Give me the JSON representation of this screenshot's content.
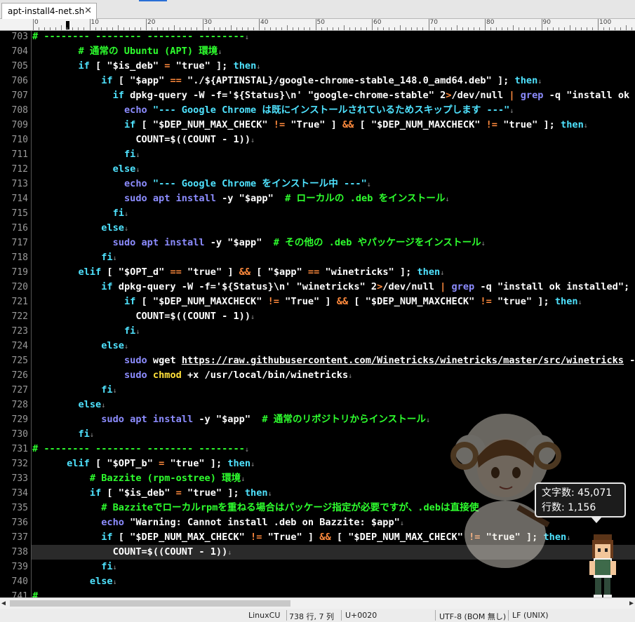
{
  "tab": {
    "title": "apt-install4-net.sh",
    "close": "✕"
  },
  "ruler": {
    "labels": [
      "0",
      "10",
      "20",
      "30",
      "40",
      "50",
      "60",
      "70",
      "80",
      "90",
      "100"
    ]
  },
  "editor": {
    "lines": [
      {
        "n": "703",
        "segs": [
          [
            "# -------- -------- -------- --------",
            "#2eff2e"
          ],
          [
            "↓",
            "#888"
          ]
        ]
      },
      {
        "n": "704",
        "segs": [
          [
            "        # 通常の Ubuntu (APT) 環境",
            "#2eff2e"
          ],
          [
            "↓",
            "#888"
          ]
        ]
      },
      {
        "n": "705",
        "segs": [
          [
            "        ",
            "#fff"
          ],
          [
            "if",
            "#4fe3ff"
          ],
          [
            " [ ",
            "#ffffff"
          ],
          [
            "\"$is_deb\"",
            "#ffffff"
          ],
          [
            " = ",
            "#ff8a3d"
          ],
          [
            "\"true\"",
            "#ffffff"
          ],
          [
            " ]; ",
            "#ffffff"
          ],
          [
            "then",
            "#4fe3ff"
          ],
          [
            "↓",
            "#888"
          ]
        ]
      },
      {
        "n": "706",
        "segs": [
          [
            "            ",
            "#fff"
          ],
          [
            "if",
            "#4fe3ff"
          ],
          [
            " [ ",
            "#ffffff"
          ],
          [
            "\"$app\"",
            "#ffffff"
          ],
          [
            " == ",
            "#ff8a3d"
          ],
          [
            "\"./${APTINSTAL}/google-chrome-stable_148.0_amd64.deb\"",
            "#ffffff"
          ],
          [
            " ]; ",
            "#ffffff"
          ],
          [
            "then",
            "#4fe3ff"
          ],
          [
            "↓",
            "#888"
          ]
        ]
      },
      {
        "n": "707",
        "segs": [
          [
            "              ",
            "#fff"
          ],
          [
            "if",
            "#4fe3ff"
          ],
          [
            " dpkg-query -W -f=",
            "#ffffff"
          ],
          [
            "'${Status}\\n'",
            "#ffffff"
          ],
          [
            " \"google-chrome-stable\" 2",
            "#ffffff"
          ],
          [
            ">",
            "#ff8a3d"
          ],
          [
            "/dev/null ",
            "#ffffff"
          ],
          [
            "|",
            "#ff8a3d"
          ],
          [
            " ",
            "#fff"
          ],
          [
            "grep",
            "#8c8cff"
          ],
          [
            " -q \"install ok in",
            "#ffffff"
          ]
        ]
      },
      {
        "n": "708",
        "segs": [
          [
            "                ",
            "#fff"
          ],
          [
            "echo",
            "#8c8cff"
          ],
          [
            " \"--- Google Chrome は既にインストールされているためスキップします ---\"",
            "#4fe3ff"
          ],
          [
            "↓",
            "#888"
          ]
        ]
      },
      {
        "n": "709",
        "segs": [
          [
            "                ",
            "#fff"
          ],
          [
            "if",
            "#4fe3ff"
          ],
          [
            " [ ",
            "#ffffff"
          ],
          [
            "\"$DEP_NUM_MAX_CHECK\"",
            "#ffffff"
          ],
          [
            " != ",
            "#ff8a3d"
          ],
          [
            "\"True\"",
            "#ffffff"
          ],
          [
            " ] ",
            "#ffffff"
          ],
          [
            "&&",
            "#ff8a3d"
          ],
          [
            " [ ",
            "#ffffff"
          ],
          [
            "\"$DEP_NUM_MAXCHECK\"",
            "#ffffff"
          ],
          [
            " != ",
            "#ff8a3d"
          ],
          [
            "\"true\"",
            "#ffffff"
          ],
          [
            " ]; ",
            "#ffffff"
          ],
          [
            "then",
            "#4fe3ff"
          ],
          [
            "↓",
            "#888"
          ]
        ]
      },
      {
        "n": "710",
        "segs": [
          [
            "                  COUNT=$((COUNT - 1))",
            "#ffffff"
          ],
          [
            "↓",
            "#888"
          ]
        ]
      },
      {
        "n": "711",
        "segs": [
          [
            "                ",
            "#fff"
          ],
          [
            "fi",
            "#4fe3ff"
          ],
          [
            "↓",
            "#888"
          ]
        ]
      },
      {
        "n": "712",
        "segs": [
          [
            "              ",
            "#fff"
          ],
          [
            "else",
            "#4fe3ff"
          ],
          [
            "↓",
            "#888"
          ]
        ]
      },
      {
        "n": "713",
        "segs": [
          [
            "                ",
            "#fff"
          ],
          [
            "echo",
            "#8c8cff"
          ],
          [
            " \"--- Google Chrome をインストール中 ---\"",
            "#4fe3ff"
          ],
          [
            "↓",
            "#888"
          ]
        ]
      },
      {
        "n": "714",
        "segs": [
          [
            "                ",
            "#fff"
          ],
          [
            "sudo apt install",
            "#8c8cff"
          ],
          [
            " -y ",
            "#ffffff"
          ],
          [
            "\"$app\"",
            "#ffffff"
          ],
          [
            "  # ローカルの .deb をインストール",
            "#2eff2e"
          ],
          [
            "↓",
            "#888"
          ]
        ]
      },
      {
        "n": "715",
        "segs": [
          [
            "              ",
            "#fff"
          ],
          [
            "fi",
            "#4fe3ff"
          ],
          [
            "↓",
            "#888"
          ]
        ]
      },
      {
        "n": "716",
        "segs": [
          [
            "            ",
            "#fff"
          ],
          [
            "else",
            "#4fe3ff"
          ],
          [
            "↓",
            "#888"
          ]
        ]
      },
      {
        "n": "717",
        "segs": [
          [
            "              ",
            "#fff"
          ],
          [
            "sudo apt install",
            "#8c8cff"
          ],
          [
            " -y ",
            "#ffffff"
          ],
          [
            "\"$app\"",
            "#ffffff"
          ],
          [
            "  # その他の .deb やパッケージをインストール",
            "#2eff2e"
          ],
          [
            "↓",
            "#888"
          ]
        ]
      },
      {
        "n": "718",
        "segs": [
          [
            "            ",
            "#fff"
          ],
          [
            "fi",
            "#4fe3ff"
          ],
          [
            "↓",
            "#888"
          ]
        ]
      },
      {
        "n": "719",
        "segs": [
          [
            "        ",
            "#fff"
          ],
          [
            "elif",
            "#4fe3ff"
          ],
          [
            " [ ",
            "#ffffff"
          ],
          [
            "\"$OPT_d\"",
            "#ffffff"
          ],
          [
            " == ",
            "#ff8a3d"
          ],
          [
            "\"true\"",
            "#ffffff"
          ],
          [
            " ] ",
            "#ffffff"
          ],
          [
            "&&",
            "#ff8a3d"
          ],
          [
            " [ ",
            "#ffffff"
          ],
          [
            "\"$app\"",
            "#ffffff"
          ],
          [
            " == ",
            "#ff8a3d"
          ],
          [
            "\"winetricks\"",
            "#ffffff"
          ],
          [
            " ]; ",
            "#ffffff"
          ],
          [
            "then",
            "#4fe3ff"
          ],
          [
            "↓",
            "#888"
          ]
        ]
      },
      {
        "n": "720",
        "segs": [
          [
            "            ",
            "#fff"
          ],
          [
            "if",
            "#4fe3ff"
          ],
          [
            " dpkg-query -W -f=",
            "#ffffff"
          ],
          [
            "'${Status}\\n'",
            "#ffffff"
          ],
          [
            " \"winetricks\" 2",
            "#ffffff"
          ],
          [
            ">",
            "#ff8a3d"
          ],
          [
            "/dev/null ",
            "#ffffff"
          ],
          [
            "|",
            "#ff8a3d"
          ],
          [
            " ",
            "#fff"
          ],
          [
            "grep",
            "#8c8cff"
          ],
          [
            " -q \"install ok installed\"; ",
            "#ffffff"
          ],
          [
            "th",
            "#4fe3ff"
          ]
        ]
      },
      {
        "n": "721",
        "segs": [
          [
            "                ",
            "#fff"
          ],
          [
            "if",
            "#4fe3ff"
          ],
          [
            " [ ",
            "#ffffff"
          ],
          [
            "\"$DEP_NUM_MAXCHECK\"",
            "#ffffff"
          ],
          [
            " != ",
            "#ff8a3d"
          ],
          [
            "\"True\"",
            "#ffffff"
          ],
          [
            " ] ",
            "#ffffff"
          ],
          [
            "&&",
            "#ff8a3d"
          ],
          [
            " [ ",
            "#ffffff"
          ],
          [
            "\"$DEP_NUM_MAXCHECK\"",
            "#ffffff"
          ],
          [
            " != ",
            "#ff8a3d"
          ],
          [
            "\"true\"",
            "#ffffff"
          ],
          [
            " ]; ",
            "#ffffff"
          ],
          [
            "then",
            "#4fe3ff"
          ],
          [
            "↓",
            "#888"
          ]
        ]
      },
      {
        "n": "722",
        "segs": [
          [
            "                  COUNT=$((COUNT - 1))",
            "#ffffff"
          ],
          [
            "↓",
            "#888"
          ]
        ]
      },
      {
        "n": "723",
        "segs": [
          [
            "                ",
            "#fff"
          ],
          [
            "fi",
            "#4fe3ff"
          ],
          [
            "↓",
            "#888"
          ]
        ]
      },
      {
        "n": "724",
        "segs": [
          [
            "            ",
            "#fff"
          ],
          [
            "else",
            "#4fe3ff"
          ],
          [
            "↓",
            "#888"
          ]
        ]
      },
      {
        "n": "725",
        "segs": [
          [
            "                ",
            "#fff"
          ],
          [
            "sudo",
            "#8c8cff"
          ],
          [
            " wget ",
            "#ffffff"
          ],
          [
            "https://raw.githubusercontent.com/Winetricks/winetricks/master/src/winetricks",
            "#ffffff",
            "u"
          ],
          [
            " -O",
            "#ffffff"
          ]
        ]
      },
      {
        "n": "726",
        "segs": [
          [
            "                ",
            "#fff"
          ],
          [
            "sudo",
            "#8c8cff"
          ],
          [
            " ",
            "#fff"
          ],
          [
            "chmod",
            "#ffe03a"
          ],
          [
            " +x /usr/local/bin/winetricks",
            "#ffffff"
          ],
          [
            "↓",
            "#888"
          ]
        ]
      },
      {
        "n": "727",
        "segs": [
          [
            "            ",
            "#fff"
          ],
          [
            "fi",
            "#4fe3ff"
          ],
          [
            "↓",
            "#888"
          ]
        ]
      },
      {
        "n": "728",
        "segs": [
          [
            "        ",
            "#fff"
          ],
          [
            "else",
            "#4fe3ff"
          ],
          [
            "↓",
            "#888"
          ]
        ]
      },
      {
        "n": "729",
        "segs": [
          [
            "            ",
            "#fff"
          ],
          [
            "sudo apt install",
            "#8c8cff"
          ],
          [
            " -y ",
            "#ffffff"
          ],
          [
            "\"$app\"",
            "#ffffff"
          ],
          [
            "  # 通常のリポジトリからインストール",
            "#2eff2e"
          ],
          [
            "↓",
            "#888"
          ]
        ]
      },
      {
        "n": "730",
        "segs": [
          [
            "        ",
            "#fff"
          ],
          [
            "fi",
            "#4fe3ff"
          ],
          [
            "↓",
            "#888"
          ]
        ]
      },
      {
        "n": "731",
        "segs": [
          [
            "# -------- -------- -------- --------",
            "#2eff2e"
          ],
          [
            "↓",
            "#888"
          ]
        ]
      },
      {
        "n": "732",
        "segs": [
          [
            "      ",
            "#fff"
          ],
          [
            "elif",
            "#4fe3ff"
          ],
          [
            " [ ",
            "#ffffff"
          ],
          [
            "\"$OPT_b\"",
            "#ffffff"
          ],
          [
            " = ",
            "#ff8a3d"
          ],
          [
            "\"true\"",
            "#ffffff"
          ],
          [
            " ]; ",
            "#ffffff"
          ],
          [
            "then",
            "#4fe3ff"
          ],
          [
            "↓",
            "#888"
          ]
        ]
      },
      {
        "n": "733",
        "segs": [
          [
            "          # Bazzite (rpm-ostree) 環境",
            "#2eff2e"
          ],
          [
            "↓",
            "#888"
          ]
        ]
      },
      {
        "n": "734",
        "segs": [
          [
            "          ",
            "#fff"
          ],
          [
            "if",
            "#4fe3ff"
          ],
          [
            " [ ",
            "#ffffff"
          ],
          [
            "\"$is_deb\"",
            "#ffffff"
          ],
          [
            " = ",
            "#ff8a3d"
          ],
          [
            "\"true\"",
            "#ffffff"
          ],
          [
            " ]; ",
            "#ffffff"
          ],
          [
            "then",
            "#4fe3ff"
          ],
          [
            "↓",
            "#888"
          ]
        ]
      },
      {
        "n": "735",
        "segs": [
          [
            "            # Bazziteでローカルrpmを重ねる場合はパッケージ指定が必要ですが、.debは直接使",
            "#2eff2e"
          ]
        ]
      },
      {
        "n": "736",
        "segs": [
          [
            "            ",
            "#fff"
          ],
          [
            "echo",
            "#8c8cff"
          ],
          [
            " \"Warning: Cannot install .deb on Bazzite: $app\"",
            "#ffffff"
          ],
          [
            "↓",
            "#888"
          ]
        ]
      },
      {
        "n": "737",
        "segs": [
          [
            "            ",
            "#fff"
          ],
          [
            "if",
            "#4fe3ff"
          ],
          [
            " [ ",
            "#ffffff"
          ],
          [
            "\"$DEP_NUM_MAX_CHECK\"",
            "#ffffff"
          ],
          [
            " != ",
            "#ff8a3d"
          ],
          [
            "\"True\"",
            "#ffffff"
          ],
          [
            " ] ",
            "#ffffff"
          ],
          [
            "&&",
            "#ff8a3d"
          ],
          [
            " [ ",
            "#ffffff"
          ],
          [
            "\"$DEP_NUM_MAX_CHECK\"",
            "#ffffff"
          ],
          [
            " != ",
            "#ff8a3d"
          ],
          [
            "\"true\"",
            "#ffffff"
          ],
          [
            " ]; ",
            "#ffffff"
          ],
          [
            "then",
            "#4fe3ff"
          ],
          [
            "↓",
            "#888"
          ]
        ]
      },
      {
        "n": "738",
        "segs": [
          [
            "              COUNT=$((COUNT - 1))",
            "#ffffff"
          ],
          [
            "↓",
            "#888"
          ]
        ],
        "current": true
      },
      {
        "n": "739",
        "segs": [
          [
            "            ",
            "#fff"
          ],
          [
            "fi",
            "#4fe3ff"
          ],
          [
            "↓",
            "#888"
          ]
        ]
      },
      {
        "n": "740",
        "segs": [
          [
            "          ",
            "#fff"
          ],
          [
            "else",
            "#4fe3ff"
          ],
          [
            "↓",
            "#888"
          ]
        ]
      },
      {
        "n": "741",
        "segs": [
          [
            "#",
            "#2eff2e"
          ]
        ]
      }
    ]
  },
  "counter": {
    "chars": "文字数: 45,071",
    "lines": "行数: 1,156"
  },
  "status": {
    "items": [
      "",
      "LinuxCU",
      "738 行, 7 列",
      "U+0020",
      "",
      "UTF-8 (BOM 無し)",
      "LF (UNIX)"
    ]
  },
  "colors": {
    "comment": "#2eff2e",
    "keyword": "#4fe3ff",
    "builtin": "#8c8cff",
    "operator": "#ff8a3d",
    "string": "#ffffff"
  }
}
